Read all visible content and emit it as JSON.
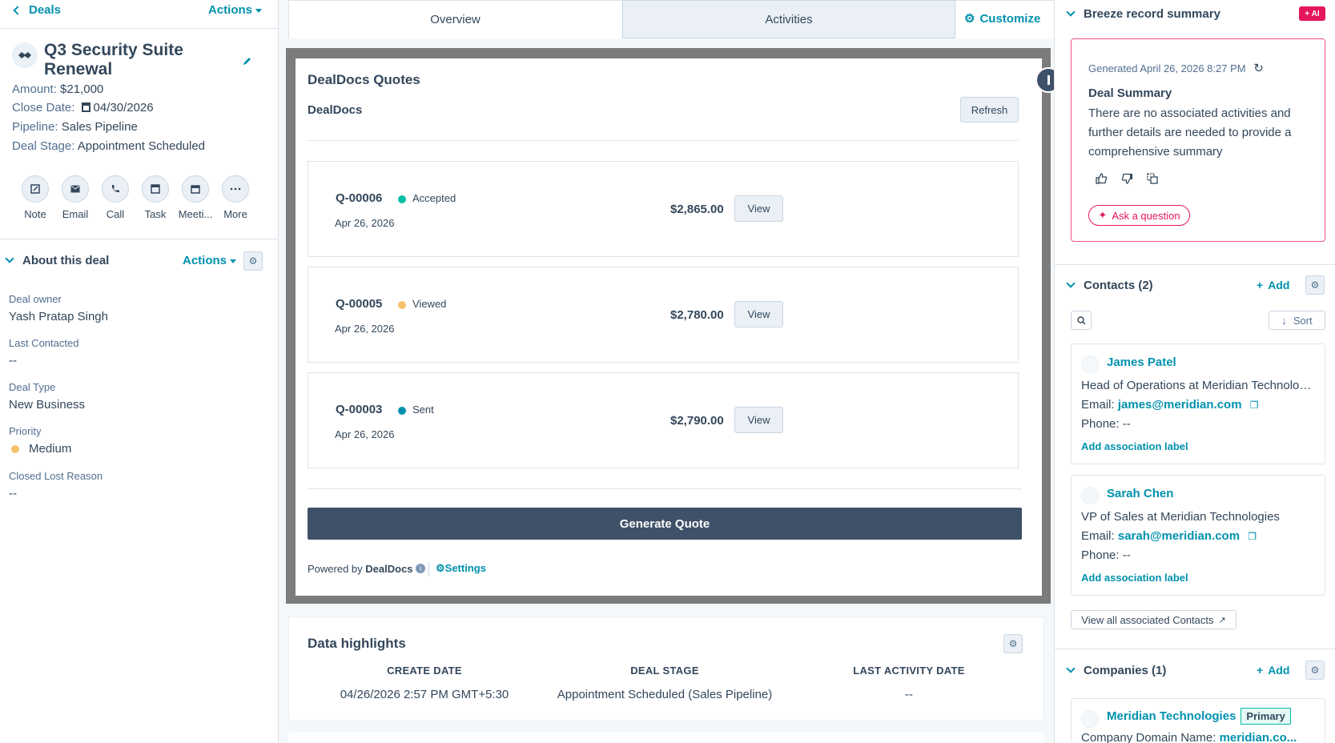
{
  "left": {
    "back_label": "Deals",
    "actions_label": "Actions",
    "deal_title": "Q3 Security Suite Renewal",
    "props": [
      {
        "key": "Amount:",
        "value": "$21,000"
      },
      {
        "key": "Close Date:",
        "value": "04/30/2026"
      },
      {
        "key": "Pipeline:",
        "value": "Sales Pipeline"
      },
      {
        "key": "Deal Stage:",
        "value": "Appointment Scheduled"
      }
    ],
    "activity_buttons": [
      "Note",
      "Email",
      "Call",
      "Task",
      "Meeti...",
      "More"
    ],
    "about": {
      "title": "About this deal",
      "actions_label": "Actions",
      "fields": [
        {
          "label": "Deal owner",
          "value": "Yash Pratap Singh"
        },
        {
          "label": "Last Contacted",
          "value": "--"
        },
        {
          "label": "Deal Type",
          "value": "New Business"
        },
        {
          "label": "Priority",
          "value": "Medium"
        },
        {
          "label": "Closed Lost Reason",
          "value": "--"
        }
      ],
      "priority_color": "#f5c26b"
    }
  },
  "middle": {
    "tabs": [
      "Overview",
      "Activities"
    ],
    "customize_label": "Customize",
    "dealdocs": {
      "card_title": "DealDocs Quotes",
      "subtitle": "DealDocs",
      "refresh_label": "Refresh",
      "quotes": [
        {
          "id": "Q-00006",
          "status": "Accepted",
          "status_color": "#00bda5",
          "date": "Apr 26, 2026",
          "amount": "$2,865.00",
          "view_label": "View"
        },
        {
          "id": "Q-00005",
          "status": "Viewed",
          "status_color": "#f5c26b",
          "date": "Apr 26, 2026",
          "amount": "$2,780.00",
          "view_label": "View"
        },
        {
          "id": "Q-00003",
          "status": "Sent",
          "status_color": "#0091ae",
          "date": "Apr 26, 2026",
          "amount": "$2,790.00",
          "view_label": "View"
        }
      ],
      "generate_label": "Generate Quote",
      "powered_prefix": "Powered by",
      "powered_brand": "DealDocs",
      "settings_label": "Settings"
    },
    "highlights": {
      "title": "Data highlights",
      "columns": [
        {
          "header": "CREATE DATE",
          "value": "04/26/2026 2:57 PM GMT+5:30"
        },
        {
          "header": "DEAL STAGE",
          "value": "Appointment Scheduled (Sales Pipeline)"
        },
        {
          "header": "LAST ACTIVITY DATE",
          "value": "--"
        }
      ]
    }
  },
  "right": {
    "breeze": {
      "title": "Breeze record summary",
      "ai_badge": "+ AI",
      "generated": "Generated April 26, 2026 8:27 PM",
      "summary_title": "Deal Summary",
      "summary_text": "There are no associated activities and further details are needed to provide a comprehensive summary",
      "ask_label": "Ask a question"
    },
    "contacts": {
      "title": "Contacts (2)",
      "add_label": "Add",
      "sort_label": "Sort",
      "items": [
        {
          "name": "James Patel",
          "role": "Head of Operations at Meridian Technologi...",
          "email_label": "Email:",
          "email": "james@meridian.com",
          "phone_label": "Phone:",
          "phone": "--",
          "assoc_label": "Add association label"
        },
        {
          "name": "Sarah Chen",
          "role": "VP of Sales at Meridian Technologies",
          "email_label": "Email:",
          "email": "sarah@meridian.com",
          "phone_label": "Phone:",
          "phone": "--",
          "assoc_label": "Add association label"
        }
      ],
      "view_all_label": "View all associated Contacts"
    },
    "companies": {
      "title": "Companies (1)",
      "add_label": "Add",
      "company_name": "Meridian Technologies",
      "primary_label": "Primary",
      "domain_label": "Company Domain Name:",
      "domain_value": "meridian.co..."
    }
  }
}
